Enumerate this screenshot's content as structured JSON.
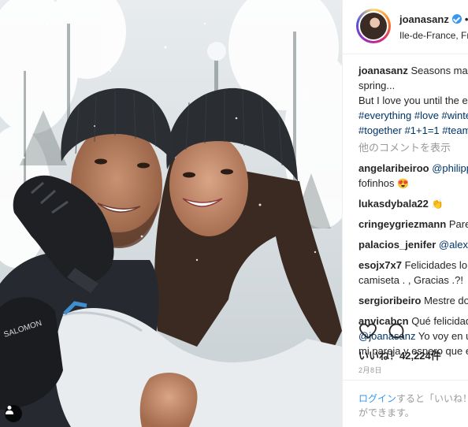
{
  "post": {
    "username": "joanasanz",
    "separator": "•",
    "location": "Ile-de-France, France"
  },
  "caption": {
    "username": "joanasanz",
    "text_line1": "Seasons may change...",
    "text_line2": "spring...",
    "text_line3": "But I love you until the end",
    "hashtags_line1": [
      "#everything",
      "#love",
      "#winter"
    ],
    "hashtags_line2": [
      "#together",
      "#1+1=1",
      "#teamwork"
    ]
  },
  "view_comments_label": "他のコメントを表示",
  "comments": [
    {
      "username": "angelaribeiroo",
      "mention": "@philippecoutinho",
      "line2": "fofinhos",
      "emoji": "😍"
    },
    {
      "username": "lukasdybala22",
      "text": "",
      "emoji": "👏"
    },
    {
      "username": "cringeygriezmann",
      "text": "Pare"
    },
    {
      "username": "palacios_jenifer",
      "mention": "@alex_"
    },
    {
      "username": "esojx7x7",
      "text": "Felicidades lo",
      "line2": "camiseta . , Gracias .?!"
    },
    {
      "username": "sergioribeiro",
      "text": "Mestre do"
    },
    {
      "username": "anvicabcn",
      "text": "Qué felicidad",
      "line2_mention": "@joanasanz",
      "line2_text": "Yo voy en u",
      "line3": "mi pareja y espero que e"
    }
  ],
  "likes_label": "いいね！42,224件",
  "date": "2月8日",
  "footer": {
    "login_link": "ログイン",
    "text_line1": "すると「いいね！」",
    "text_line2": "ができます。"
  },
  "icons": {
    "like": "heart-icon",
    "comment": "comment-icon",
    "tag": "person-tag-icon",
    "verified": "verified-badge-icon"
  },
  "colors": {
    "link": "#003569",
    "login": "#3897f0",
    "muted": "#999999",
    "verified": "#3897f0"
  }
}
